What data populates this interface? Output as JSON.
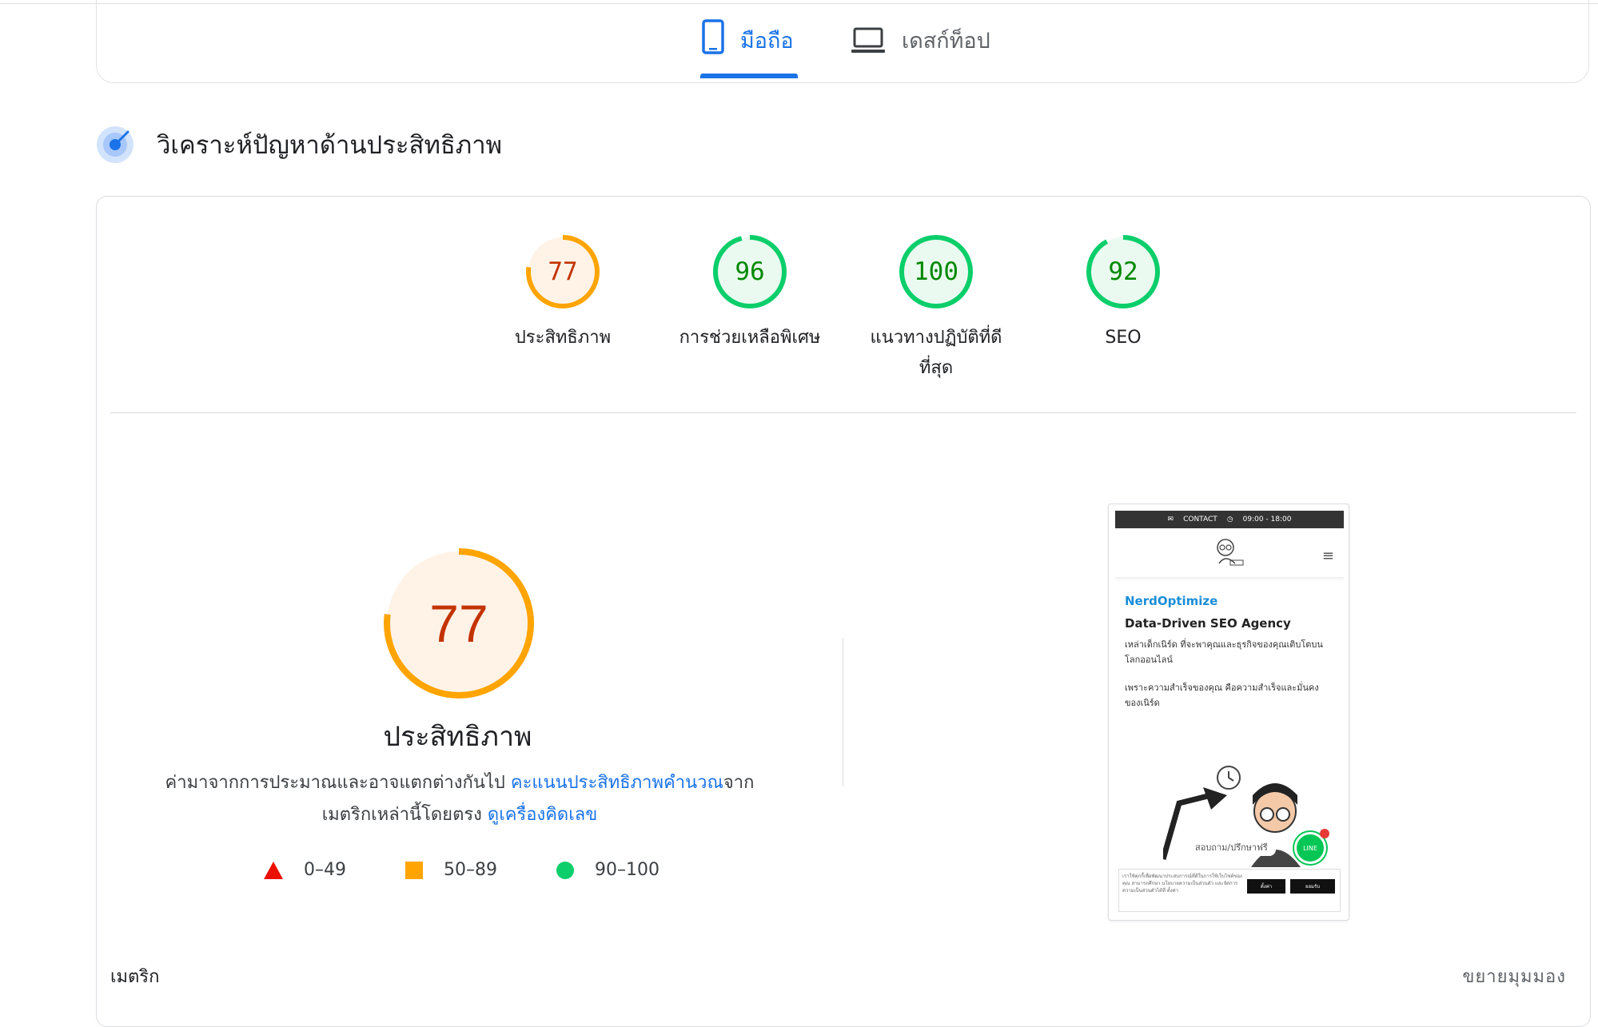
{
  "tabs": {
    "mobile_label": "มือถือ",
    "desktop_label": "เดสก์ท็อป"
  },
  "section": {
    "title": "วิเคราะห์ปัญหาด้านประสิทธิภาพ"
  },
  "gauges": [
    {
      "score": "77",
      "label": "ประสิทธิภาพ",
      "value": 77,
      "status": "average"
    },
    {
      "score": "96",
      "label": "การช่วยเหลือพิเศษ",
      "value": 96,
      "status": "pass"
    },
    {
      "score": "100",
      "label_line1": "แนวทางปฏิบัติที่ดี",
      "label_line2": "ที่สุด",
      "value": 100,
      "status": "pass"
    },
    {
      "score": "92",
      "label": "SEO",
      "value": 92,
      "status": "pass"
    }
  ],
  "colors": {
    "average_stroke": "#ffa400",
    "average_text": "#c33300",
    "average_fill": "#fff3e8",
    "pass_stroke": "#0cce6b",
    "pass_text": "#008800",
    "pass_fill": "#eafaf0",
    "fail": "#eb0f00",
    "link": "#1a73e8"
  },
  "performance": {
    "score": "77",
    "value": 77,
    "title": "ประสิทธิภาพ",
    "desc_part1": "ค่ามาจากการประมาณและอาจแตกต่างกันไป ",
    "desc_link1": "คะแนนประสิทธิภาพคำนวณ",
    "desc_part2": "จาก",
    "desc_part3": "เมตริกเหล่านี้โดยตรง ",
    "desc_link2": "ดูเครื่องคิดเลข"
  },
  "legend": [
    {
      "range": "0–49",
      "shape": "triangle"
    },
    {
      "range": "50–89",
      "shape": "square"
    },
    {
      "range": "90–100",
      "shape": "circle"
    }
  ],
  "screenshot": {
    "contact": "CONTACT",
    "hours": "09:00 - 18:00",
    "brand": "NerdOptimize",
    "headline": "Data-Driven SEO Agency",
    "para1": "เหล่าเด็กเนิร์ด ที่จะพาคุณและธุรกิจของคุณเติบโตบนโลกออนไลน์",
    "para2": "เพราะความสำเร็จของคุณ คือความสำเร็จและมั่นคงของเนิร์ด",
    "consult_button": "สอบถาม/ปรึกษาฟรี",
    "line_badge": "LINE",
    "cookie_text": "เราใช้คุกกี้เพื่อพัฒนาประสบการณ์ที่ดีในการใช้เว็บไซต์ของคุณ สามารถศึกษา นโยบายความเป็นส่วนตัว และจัดการความเป็นส่วนตัวได้ที่ ตั้งค่า",
    "cookie_btn1": "ตั้งค่า",
    "cookie_btn2": "ยอมรับ"
  },
  "footer": {
    "metrics_label": "เมตริก",
    "expand_label": "ขยายมุมมอง"
  }
}
